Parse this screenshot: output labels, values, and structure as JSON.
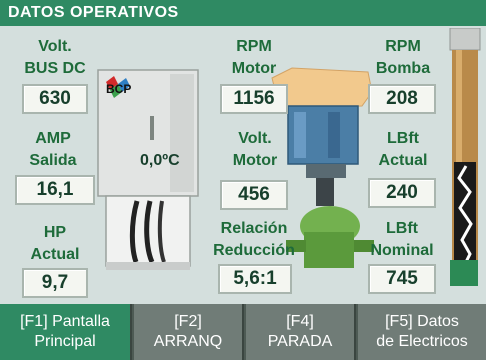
{
  "title": "DATOS OPERATIVOS",
  "logo_text": "BCP",
  "temperature": "0,0ºC",
  "fields": {
    "volt_bus_dc": {
      "label1": "Volt.",
      "label2": "BUS DC",
      "value": "630"
    },
    "amp_salida": {
      "label1": "AMP",
      "label2": "Salida",
      "value": "16,1"
    },
    "hp_actual": {
      "label1": "HP",
      "label2": "Actual",
      "value": "9,7"
    },
    "rpm_motor": {
      "label1": "RPM",
      "label2": "Motor",
      "value": "1156"
    },
    "volt_motor": {
      "label1": "Volt.",
      "label2": "Motor",
      "value": "456"
    },
    "relacion_reduccion": {
      "label1": "Relación",
      "label2": "Reducción",
      "value": "5,6:1"
    },
    "rpm_bomba": {
      "label1": "RPM",
      "label2": "Bomba",
      "value": "208"
    },
    "lbft_actual": {
      "label1": "LBft",
      "label2": "Actual",
      "value": "240"
    },
    "lbft_nominal": {
      "label1": "LBft",
      "label2": "Nominal",
      "value": "745"
    }
  },
  "function_keys": [
    {
      "line1": "[F1] Pantalla",
      "line2": "Principal"
    },
    {
      "line1": "[F2]",
      "line2": "ARRANQ"
    },
    {
      "line1": "[F4]",
      "line2": "PARADA"
    },
    {
      "line1": "[F5] Datos",
      "line2": "de Electricos"
    }
  ],
  "colors": {
    "header": "#2f8a63",
    "label_text": "#1e6b3a",
    "value_text": "#173f2c",
    "button_inactive": "#707c77"
  }
}
